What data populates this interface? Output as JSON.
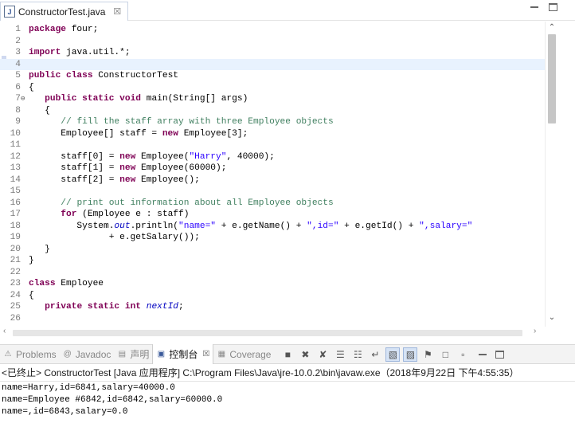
{
  "editor": {
    "tab_title": "ConstructorTest.java",
    "tab_close": "☒",
    "file_icon_letter": "J",
    "lines": [
      {
        "n": "1",
        "t": [
          {
            "k": "kw",
            "s": "package"
          },
          {
            "s": " four;"
          }
        ]
      },
      {
        "n": "2",
        "t": []
      },
      {
        "n": "3",
        "t": [
          {
            "k": "kw",
            "s": "import"
          },
          {
            "s": " java.util.*;"
          }
        ]
      },
      {
        "n": "4",
        "t": [],
        "current": true
      },
      {
        "n": "5",
        "t": [
          {
            "k": "kw",
            "s": "public class"
          },
          {
            "s": " ConstructorTest"
          }
        ]
      },
      {
        "n": "6",
        "t": [
          {
            "s": "{"
          }
        ]
      },
      {
        "n": "7",
        "fold": "⊖",
        "t": [
          {
            "s": "   "
          },
          {
            "k": "kw",
            "s": "public static void"
          },
          {
            "s": " main(String[] args)"
          }
        ]
      },
      {
        "n": "8",
        "t": [
          {
            "s": "   {"
          }
        ]
      },
      {
        "n": "9",
        "t": [
          {
            "s": "      "
          },
          {
            "k": "cm",
            "s": "// fill the staff array with three Employee objects"
          }
        ]
      },
      {
        "n": "10",
        "t": [
          {
            "s": "      Employee[] staff = "
          },
          {
            "k": "kw",
            "s": "new"
          },
          {
            "s": " Employee[3];"
          }
        ]
      },
      {
        "n": "11",
        "t": []
      },
      {
        "n": "12",
        "t": [
          {
            "s": "      staff[0] = "
          },
          {
            "k": "kw",
            "s": "new"
          },
          {
            "s": " Employee("
          },
          {
            "k": "st",
            "s": "\"Harry\""
          },
          {
            "s": ", 40000);"
          }
        ]
      },
      {
        "n": "13",
        "t": [
          {
            "s": "      staff[1] = "
          },
          {
            "k": "kw",
            "s": "new"
          },
          {
            "s": " Employee(60000);"
          }
        ]
      },
      {
        "n": "14",
        "t": [
          {
            "s": "      staff[2] = "
          },
          {
            "k": "kw",
            "s": "new"
          },
          {
            "s": " Employee();"
          }
        ]
      },
      {
        "n": "15",
        "t": []
      },
      {
        "n": "16",
        "t": [
          {
            "s": "      "
          },
          {
            "k": "cm",
            "s": "// print out information about all Employee objects"
          }
        ]
      },
      {
        "n": "17",
        "t": [
          {
            "s": "      "
          },
          {
            "k": "kw",
            "s": "for"
          },
          {
            "s": " (Employee e : staff)"
          }
        ]
      },
      {
        "n": "18",
        "t": [
          {
            "s": "         System."
          },
          {
            "k": "sfld",
            "s": "out"
          },
          {
            "s": ".println("
          },
          {
            "k": "st",
            "s": "\"name=\""
          },
          {
            "s": " + e.getName() + "
          },
          {
            "k": "st",
            "s": "\",id=\""
          },
          {
            "s": " + e.getId() + "
          },
          {
            "k": "st",
            "s": "\",salary=\""
          }
        ]
      },
      {
        "n": "19",
        "t": [
          {
            "s": "               + e.getSalary());"
          }
        ]
      },
      {
        "n": "20",
        "t": [
          {
            "s": "   }"
          }
        ]
      },
      {
        "n": "21",
        "t": [
          {
            "s": "}"
          }
        ]
      },
      {
        "n": "22",
        "t": []
      },
      {
        "n": "23",
        "t": [
          {
            "k": "kw",
            "s": "class"
          },
          {
            "s": " Employee"
          }
        ]
      },
      {
        "n": "24",
        "t": [
          {
            "s": "{"
          }
        ]
      },
      {
        "n": "25",
        "t": [
          {
            "s": "   "
          },
          {
            "k": "kw",
            "s": "private static int"
          },
          {
            "s": " "
          },
          {
            "k": "sfld",
            "s": "nextId"
          },
          {
            "s": ";"
          }
        ]
      },
      {
        "n": "26",
        "t": []
      }
    ]
  },
  "console": {
    "tabs": [
      {
        "label": "Problems",
        "icon": "problems-icon",
        "glyph": "⚠",
        "active": false
      },
      {
        "label": "Javadoc",
        "icon": "javadoc-icon",
        "glyph": "@",
        "active": false
      },
      {
        "label": "声明",
        "icon": "declaration-icon",
        "glyph": "▤",
        "active": false
      },
      {
        "label": "控制台",
        "icon": "console-icon",
        "glyph": "▣",
        "active": true
      },
      {
        "label": "Coverage",
        "icon": "coverage-icon",
        "glyph": "▦",
        "active": false
      }
    ],
    "tab_close": "☒",
    "tools": [
      {
        "name": "stop-icon",
        "glyph": "■"
      },
      {
        "name": "remove-launch-icon",
        "glyph": "✖"
      },
      {
        "name": "remove-all-terminated-icon",
        "glyph": "✘"
      },
      {
        "name": "clear-console-icon",
        "glyph": "☰"
      },
      {
        "name": "scroll-lock-icon",
        "glyph": "☷"
      },
      {
        "name": "word-wrap-icon",
        "glyph": "↵"
      },
      {
        "name": "show-on-stdout-icon",
        "glyph": "▧",
        "pressed": true
      },
      {
        "name": "show-on-stderr-icon",
        "glyph": "▨",
        "pressed": true
      },
      {
        "name": "pin-console-icon",
        "glyph": "⚑"
      },
      {
        "name": "display-console-icon",
        "glyph": "□"
      },
      {
        "name": "open-console-icon",
        "glyph": "▫"
      }
    ],
    "status": "<已终止> ConstructorTest [Java 应用程序] C:\\Program Files\\Java\\jre-10.0.2\\bin\\javaw.exe（2018年9月22日 下午4:55:35）",
    "output": [
      "name=Harry,id=6841,salary=40000.0",
      "name=Employee #6842,id=6842,salary=60000.0",
      "name=,id=6843,salary=0.0"
    ]
  }
}
